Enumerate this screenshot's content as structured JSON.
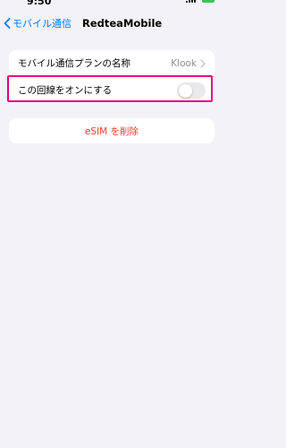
{
  "status_bar": {
    "time": "9:50"
  },
  "nav": {
    "back_label": "モバイル通信",
    "title": "RedteaMobile"
  },
  "settings": {
    "plan_name_label": "モバイル通信プランの名称",
    "plan_name_value": "Klook",
    "line_on_label": "この回線をオンにする",
    "line_on_toggle": false
  },
  "delete_button_label": "eSIM を削除",
  "colors": {
    "accent": "#007aff",
    "destructive": "#ff3b30",
    "highlight": "#e4007f",
    "background": "#f2f2f7"
  }
}
